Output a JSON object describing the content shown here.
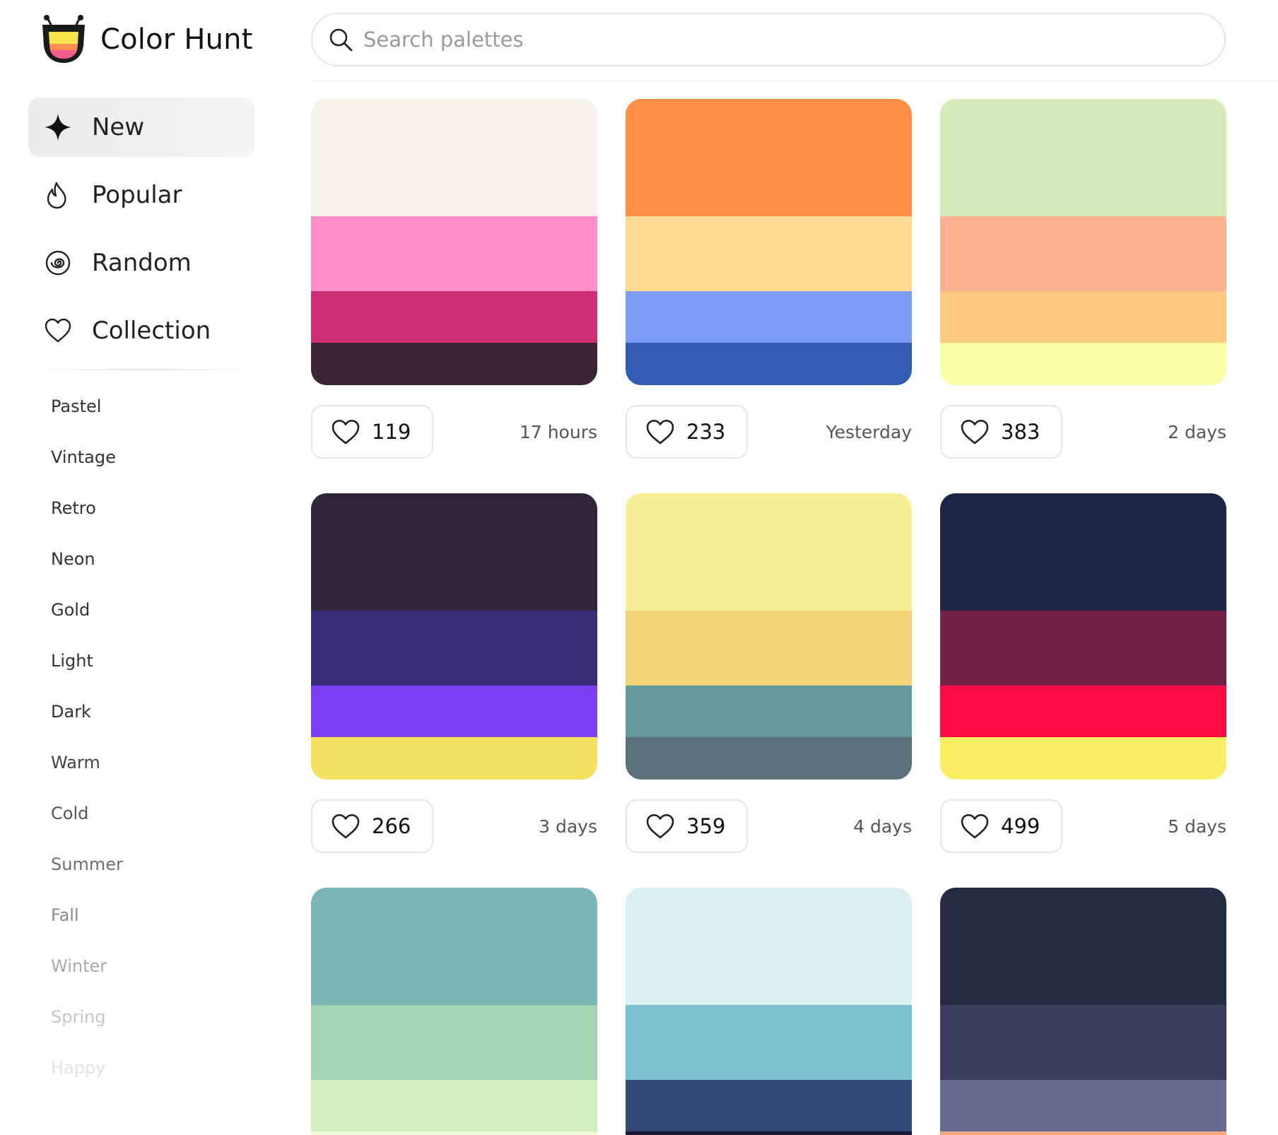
{
  "app": {
    "name": "Color Hunt"
  },
  "search": {
    "placeholder": "Search palettes"
  },
  "nav": [
    {
      "label": "New",
      "icon": "sparkle-icon",
      "active": true
    },
    {
      "label": "Popular",
      "icon": "flame-icon",
      "active": false
    },
    {
      "label": "Random",
      "icon": "spiral-icon",
      "active": false
    },
    {
      "label": "Collection",
      "icon": "heart-icon",
      "active": false
    }
  ],
  "tags": [
    {
      "label": "Pastel",
      "color": "#333333"
    },
    {
      "label": "Vintage",
      "color": "#333333"
    },
    {
      "label": "Retro",
      "color": "#333333"
    },
    {
      "label": "Neon",
      "color": "#333333"
    },
    {
      "label": "Gold",
      "color": "#333333"
    },
    {
      "label": "Light",
      "color": "#333333"
    },
    {
      "label": "Dark",
      "color": "#333333"
    },
    {
      "label": "Warm",
      "color": "#444444"
    },
    {
      "label": "Cold",
      "color": "#555555"
    },
    {
      "label": "Summer",
      "color": "#6f6f6f"
    },
    {
      "label": "Fall",
      "color": "#8c8c8c"
    },
    {
      "label": "Winter",
      "color": "#a8a8a8"
    },
    {
      "label": "Spring",
      "color": "#c6c6c6"
    },
    {
      "label": "Happy",
      "color": "#e2e2e2"
    }
  ],
  "palettes": [
    {
      "colors": [
        "#F5F1EB",
        "#FF8FCA",
        "#CD2F74",
        "#3A2733"
      ],
      "likes": "119",
      "time": "17 hours"
    },
    {
      "colors": [
        "#FF8F47",
        "#FDD991",
        "#7F9CF5",
        "#325CB4"
      ],
      "likes": "233",
      "time": "Yesterday"
    },
    {
      "colors": [
        "#D4EBB9",
        "#FCB290",
        "#FDC980",
        "#FAFEA7"
      ],
      "likes": "383",
      "time": "2 days"
    },
    {
      "colors": [
        "#2F2538",
        "#382D77",
        "#7C3FF2",
        "#F6E05F"
      ],
      "likes": "266",
      "time": "3 days"
    },
    {
      "colors": [
        "#F7EE98",
        "#F2D476",
        "#65999C",
        "#5B727C"
      ],
      "likes": "359",
      "time": "4 days"
    },
    {
      "colors": [
        "#1C2647",
        "#732145",
        "#FB0A43",
        "#F9EE63"
      ],
      "likes": "499",
      "time": "5 days"
    },
    {
      "colors": [
        "#7AB6B5",
        "#A3D4B3",
        "#D1EEBF",
        "#F3F8D8"
      ],
      "likes": "",
      "time": ""
    },
    {
      "colors": [
        "#DBF0EF",
        "#7ABFD0",
        "#314A77",
        "#1A1833"
      ],
      "likes": "",
      "time": ""
    },
    {
      "colors": [
        "#262B42",
        "#3A3D5B",
        "#676A92",
        "#F5A97F"
      ],
      "likes": "",
      "time": ""
    }
  ]
}
